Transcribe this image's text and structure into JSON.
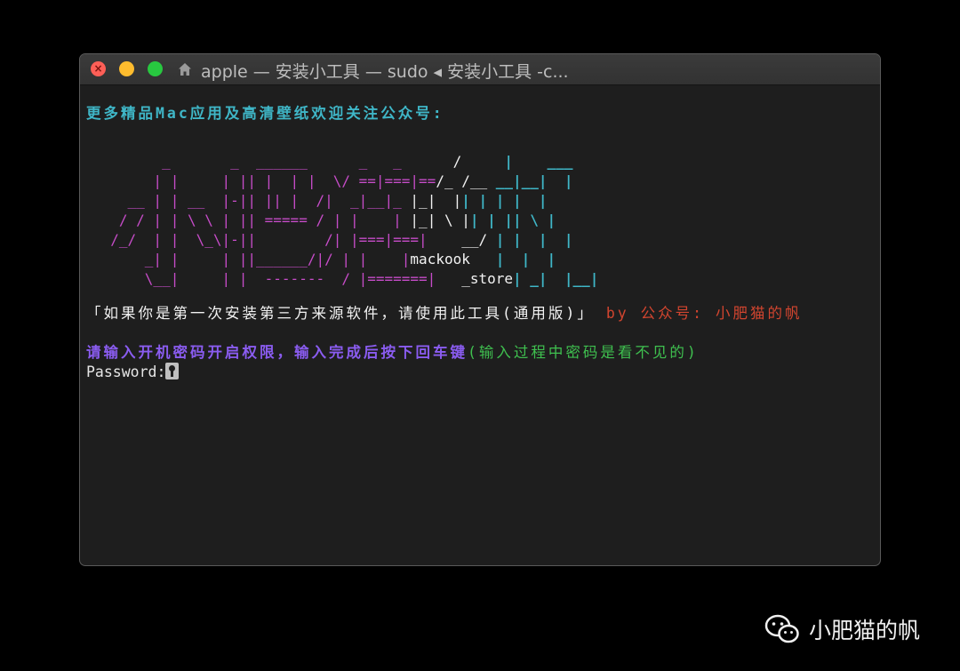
{
  "window": {
    "title": "apple — 安装小工具 — sudo ◂ 安装小工具 -c...",
    "icons": {
      "home": "home-icon",
      "close": "close-icon"
    }
  },
  "terminal": {
    "header": "更多精品Mac应用及高清壁纸欢迎关注公众号:",
    "ascii_lines": [
      [
        {
          "t": "        _       _  ______      _   _     ",
          "c": "magenta"
        },
        {
          "t": " /     ",
          "c": "white"
        },
        {
          "t": "|    ___",
          "c": "cyan"
        }
      ],
      [
        {
          "t": "       | |     | || |  | |  \\/ ==|===|==",
          "c": "magenta"
        },
        {
          "t": "/_ /__ ",
          "c": "white"
        },
        {
          "t": "__|__|  |",
          "c": "cyan"
        }
      ],
      [
        {
          "t": "    __ | | __  |-|| || |  /|  _|__|_ ",
          "c": "magenta"
        },
        {
          "t": "|_|  |",
          "c": "white"
        },
        {
          "t": "| | | |  |",
          "c": "cyan"
        }
      ],
      [
        {
          "t": "   / / | | \\ \\ | || ===== / | |    | ",
          "c": "magenta"
        },
        {
          "t": "|_| \\ |",
          "c": "white"
        },
        {
          "t": "| | || \\ |",
          "c": "cyan"
        }
      ],
      [
        {
          "t": "  /_/  | |  \\_\\|-||        /| |===|===| ",
          "c": "magenta"
        },
        {
          "t": "   __/ ",
          "c": "white"
        },
        {
          "t": "| |  |  |",
          "c": "cyan"
        }
      ],
      [
        {
          "t": "      _| |     | ||______/|/ | |    |",
          "c": "magenta"
        },
        {
          "t": "mackook",
          "c": "white"
        },
        {
          "t": "   |  |  |",
          "c": "cyan"
        }
      ],
      [
        {
          "t": "      \\__|     | |  -------  / |=======| ",
          "c": "magenta"
        },
        {
          "t": "  _store",
          "c": "white"
        },
        {
          "t": "| _|  |__|",
          "c": "cyan"
        }
      ]
    ],
    "notice": "「如果你是第一次安装第三方来源软件，请使用此工具(通用版)」",
    "byline": "by 公众号: 小肥猫的帆",
    "prompt_main": "请输入开机密码开启权限，输入完成后按下回车键",
    "prompt_hint": "(输入过程中密码是看不见的)",
    "password_label": "Password:",
    "cursor_icon": "key-icon"
  },
  "watermark": {
    "text": "小肥猫的帆",
    "icon": "wechat-icon"
  },
  "colors": {
    "header": "#3fb6c7",
    "ascii_primary": "#c64cc8",
    "ascii_secondary": "#f2f2f2",
    "ascii_tertiary": "#3fb6c7",
    "byline": "#d2452f",
    "prompt": "#8a5cf0",
    "hint": "#3fc04f"
  }
}
